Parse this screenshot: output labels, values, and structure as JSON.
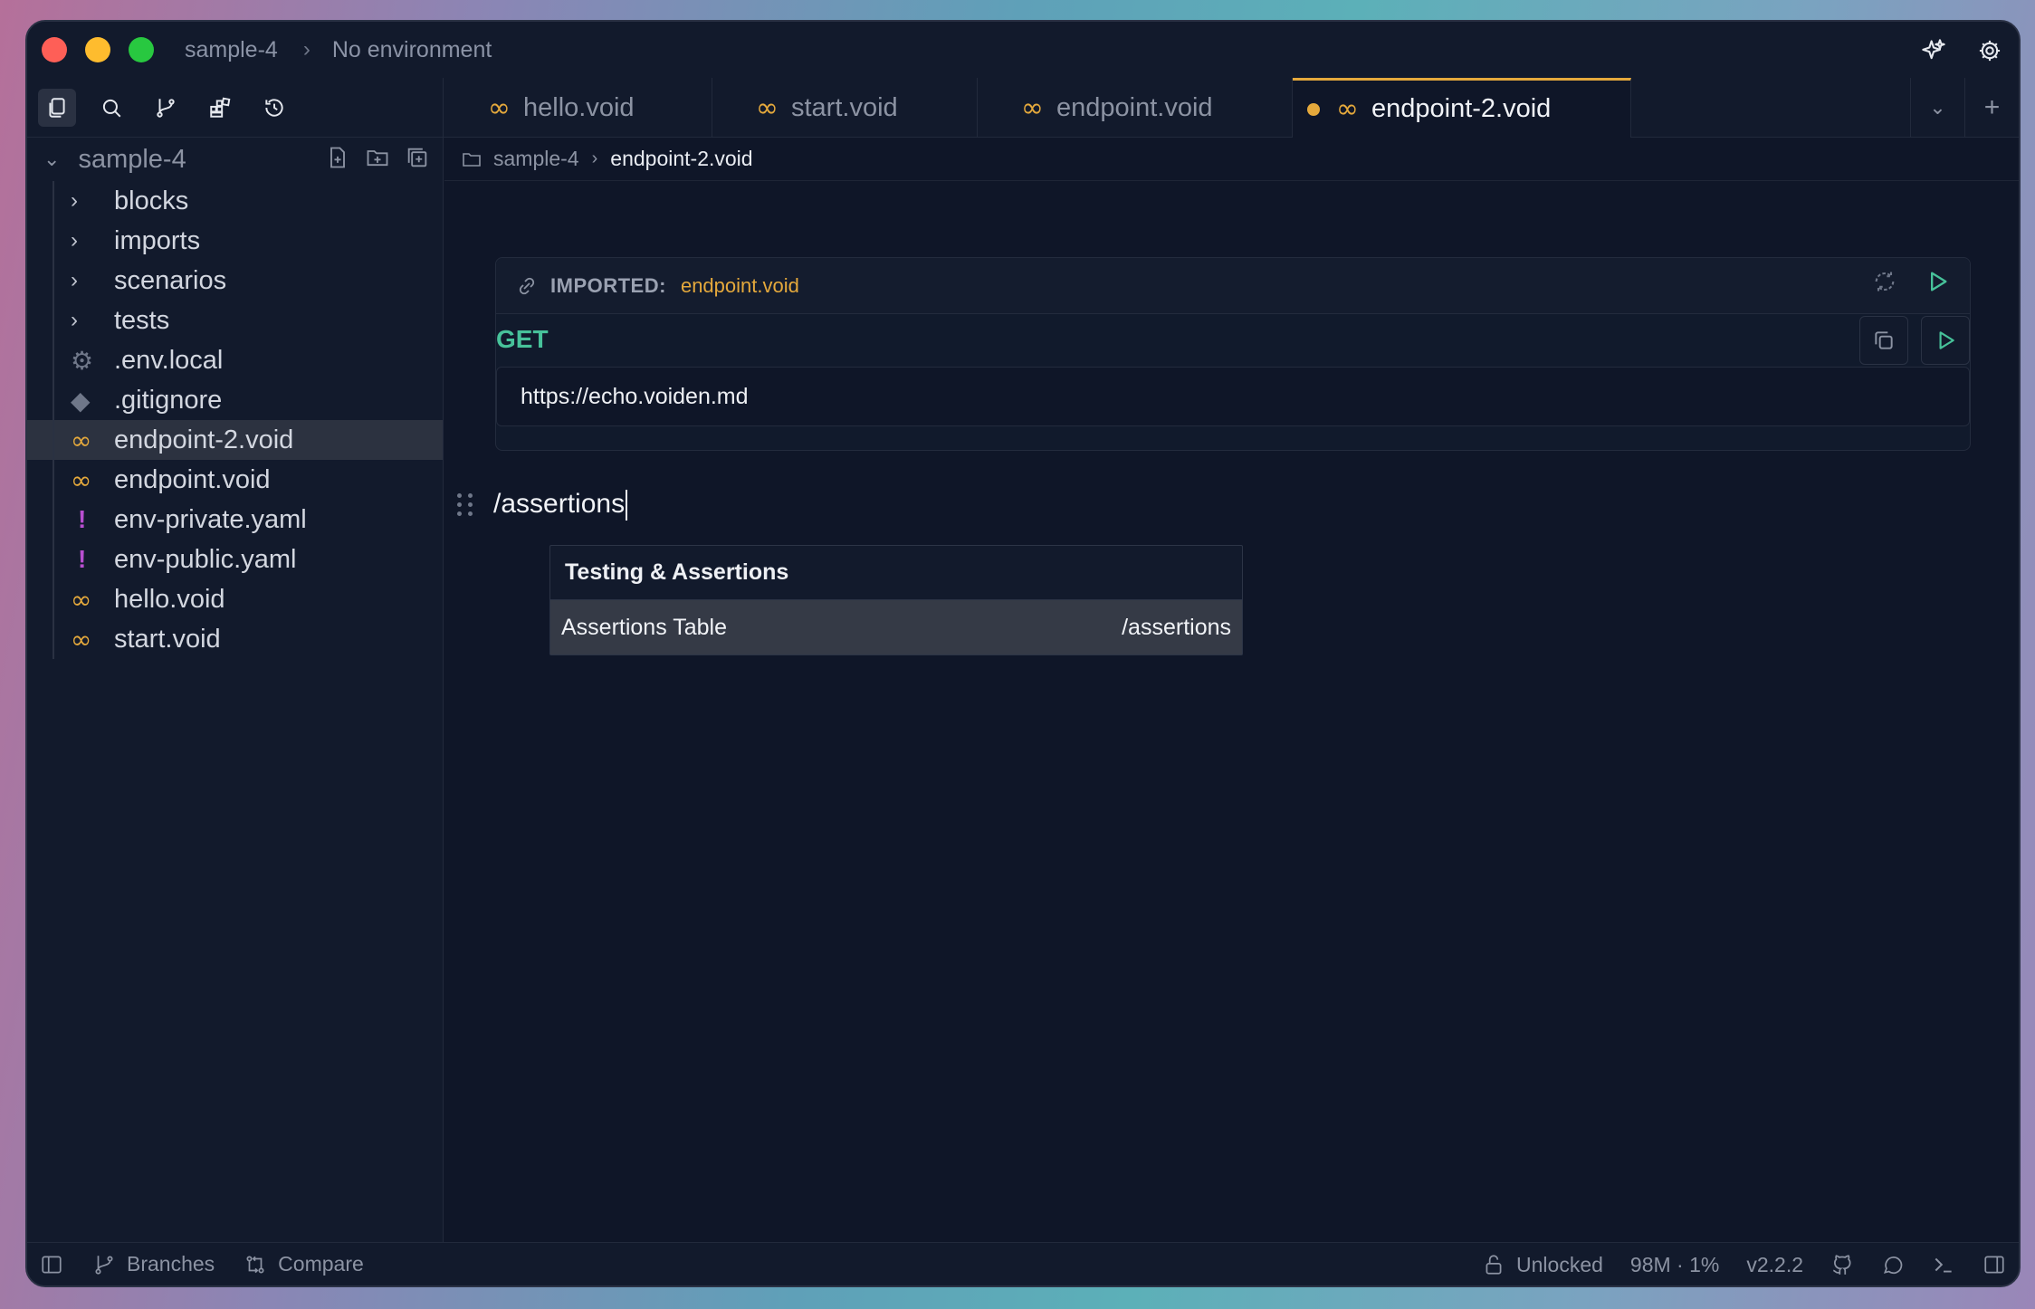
{
  "titlebar": {
    "project": "sample-4",
    "environment": "No environment"
  },
  "tabs": [
    {
      "label": "hello.void",
      "active": false
    },
    {
      "label": "start.void",
      "active": false
    },
    {
      "label": "endpoint.void",
      "active": false
    },
    {
      "label": "endpoint-2.void",
      "active": true,
      "modified": true
    }
  ],
  "sidebar": {
    "project": "sample-4",
    "items": [
      {
        "label": "blocks",
        "type": "folder"
      },
      {
        "label": "imports",
        "type": "folder"
      },
      {
        "label": "scenarios",
        "type": "folder"
      },
      {
        "label": "tests",
        "type": "folder"
      },
      {
        "label": ".env.local",
        "type": "env"
      },
      {
        "label": ".gitignore",
        "type": "git"
      },
      {
        "label": "endpoint-2.void",
        "type": "void",
        "selected": true
      },
      {
        "label": "endpoint.void",
        "type": "void"
      },
      {
        "label": "env-private.yaml",
        "type": "yaml"
      },
      {
        "label": "env-public.yaml",
        "type": "yaml"
      },
      {
        "label": "hello.void",
        "type": "void"
      },
      {
        "label": "start.void",
        "type": "void"
      }
    ]
  },
  "breadcrumb": {
    "folder": "sample-4",
    "file": "endpoint-2.void"
  },
  "block": {
    "imported_label": "IMPORTED:",
    "imported_file": "endpoint.void",
    "method": "GET",
    "url": "https://echo.voiden.md"
  },
  "command": {
    "text": "/assertions"
  },
  "popup": {
    "heading": "Testing & Assertions",
    "item_label": "Assertions Table",
    "item_command": "/assertions"
  },
  "statusbar": {
    "branches": "Branches",
    "compare": "Compare",
    "lock": "Unlocked",
    "memory": "98M · 1%",
    "version": "v2.2.2"
  },
  "colors": {
    "accent": "#e5a93c",
    "method_get": "#47c29a",
    "yaml": "#b84fd0"
  }
}
